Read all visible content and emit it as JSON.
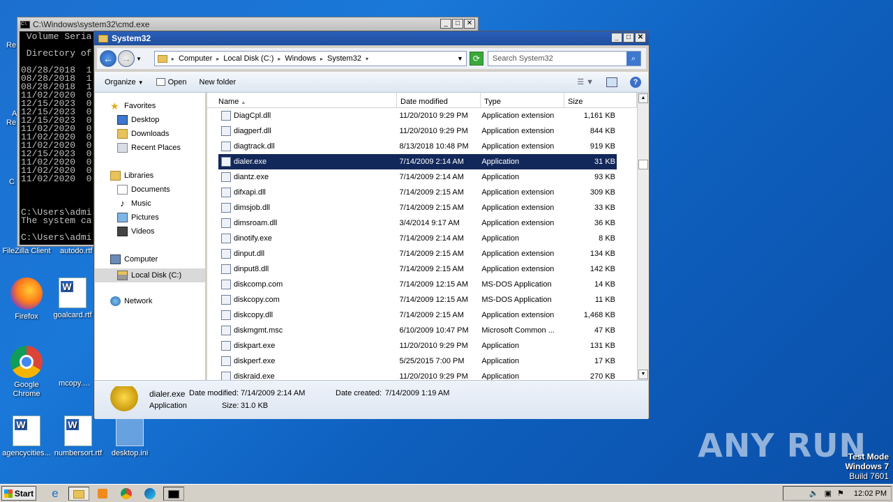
{
  "desktop": {
    "icons": [
      {
        "label": "FileZilla Client"
      },
      {
        "label": "autodo.rtf"
      },
      {
        "label": "Firefox"
      },
      {
        "label": "goalcard.rtf"
      },
      {
        "label": "Google Chrome"
      },
      {
        "label": "mcopy.png"
      },
      {
        "label": "agencycities..."
      },
      {
        "label": "numbersort.rtf"
      },
      {
        "label": "desktop.ini"
      }
    ],
    "partial_labels": [
      "Re",
      "A",
      "Re",
      "C"
    ]
  },
  "cmd": {
    "title": "C:\\Windows\\system32\\cmd.exe",
    "lines": " Volume Seria\n\n Directory of\n\n08/28/2018  1\n08/28/2018  1\n08/28/2018  1\n11/02/2020  0\n12/15/2023  0\n12/15/2023  0\n12/15/2023  0\n11/02/2020  0\n11/02/2020  0\n11/02/2020  0\n12/15/2023  0\n11/02/2020  0\n11/02/2020  0\n11/02/2020  0\n\n\n\nC:\\Users\\admi\nThe system ca\n\nC:\\Users\\admi"
  },
  "explorer": {
    "title": "System32",
    "breadcrumb": [
      "Computer",
      "Local Disk (C:)",
      "Windows",
      "System32"
    ],
    "search_placeholder": "Search System32",
    "toolbar": {
      "organize": "Organize",
      "open": "Open",
      "new_folder": "New folder"
    },
    "nav": {
      "favorites": "Favorites",
      "desktop": "Desktop",
      "downloads": "Downloads",
      "recent": "Recent Places",
      "libraries": "Libraries",
      "documents": "Documents",
      "music": "Music",
      "pictures": "Pictures",
      "videos": "Videos",
      "computer": "Computer",
      "localdisk": "Local Disk (C:)",
      "network": "Network"
    },
    "columns": {
      "name": "Name",
      "date": "Date modified",
      "type": "Type",
      "size": "Size"
    },
    "files": [
      {
        "name": "DiagCpl.dll",
        "date": "11/20/2010 9:29 PM",
        "type": "Application extension",
        "size": "1,161 KB"
      },
      {
        "name": "diagperf.dll",
        "date": "11/20/2010 9:29 PM",
        "type": "Application extension",
        "size": "844 KB"
      },
      {
        "name": "diagtrack.dll",
        "date": "8/13/2018 10:48 PM",
        "type": "Application extension",
        "size": "919 KB"
      },
      {
        "name": "dialer.exe",
        "date": "7/14/2009 2:14 AM",
        "type": "Application",
        "size": "31 KB"
      },
      {
        "name": "diantz.exe",
        "date": "7/14/2009 2:14 AM",
        "type": "Application",
        "size": "93 KB"
      },
      {
        "name": "difxapi.dll",
        "date": "7/14/2009 2:15 AM",
        "type": "Application extension",
        "size": "309 KB"
      },
      {
        "name": "dimsjob.dll",
        "date": "7/14/2009 2:15 AM",
        "type": "Application extension",
        "size": "33 KB"
      },
      {
        "name": "dimsroam.dll",
        "date": "3/4/2014 9:17 AM",
        "type": "Application extension",
        "size": "36 KB"
      },
      {
        "name": "dinotify.exe",
        "date": "7/14/2009 2:14 AM",
        "type": "Application",
        "size": "8 KB"
      },
      {
        "name": "dinput.dll",
        "date": "7/14/2009 2:15 AM",
        "type": "Application extension",
        "size": "134 KB"
      },
      {
        "name": "dinput8.dll",
        "date": "7/14/2009 2:15 AM",
        "type": "Application extension",
        "size": "142 KB"
      },
      {
        "name": "diskcomp.com",
        "date": "7/14/2009 12:15 AM",
        "type": "MS-DOS Application",
        "size": "14 KB"
      },
      {
        "name": "diskcopy.com",
        "date": "7/14/2009 12:15 AM",
        "type": "MS-DOS Application",
        "size": "11 KB"
      },
      {
        "name": "diskcopy.dll",
        "date": "7/14/2009 2:15 AM",
        "type": "Application extension",
        "size": "1,468 KB"
      },
      {
        "name": "diskmgmt.msc",
        "date": "6/10/2009 10:47 PM",
        "type": "Microsoft Common ...",
        "size": "47 KB"
      },
      {
        "name": "diskpart.exe",
        "date": "11/20/2010 9:29 PM",
        "type": "Application",
        "size": "131 KB"
      },
      {
        "name": "diskperf.exe",
        "date": "5/25/2015 7:00 PM",
        "type": "Application",
        "size": "17 KB"
      },
      {
        "name": "diskraid.exe",
        "date": "11/20/2010 9:29 PM",
        "type": "Application",
        "size": "270 KB"
      }
    ],
    "selected_index": 3,
    "details": {
      "name": "dialer.exe",
      "modified_label": "Date modified:",
      "modified": "7/14/2009 2:14 AM",
      "created_label": "Date created:",
      "created": "7/14/2009 1:19 AM",
      "type": "Application",
      "size_label": "Size:",
      "size": "31.0 KB"
    }
  },
  "taskbar": {
    "start": "Start",
    "time": "12:02 PM"
  },
  "watermark": "ANY RUN",
  "testmode": {
    "line1": "Test Mode",
    "line2": "Windows 7",
    "line3": "Build 7601"
  }
}
